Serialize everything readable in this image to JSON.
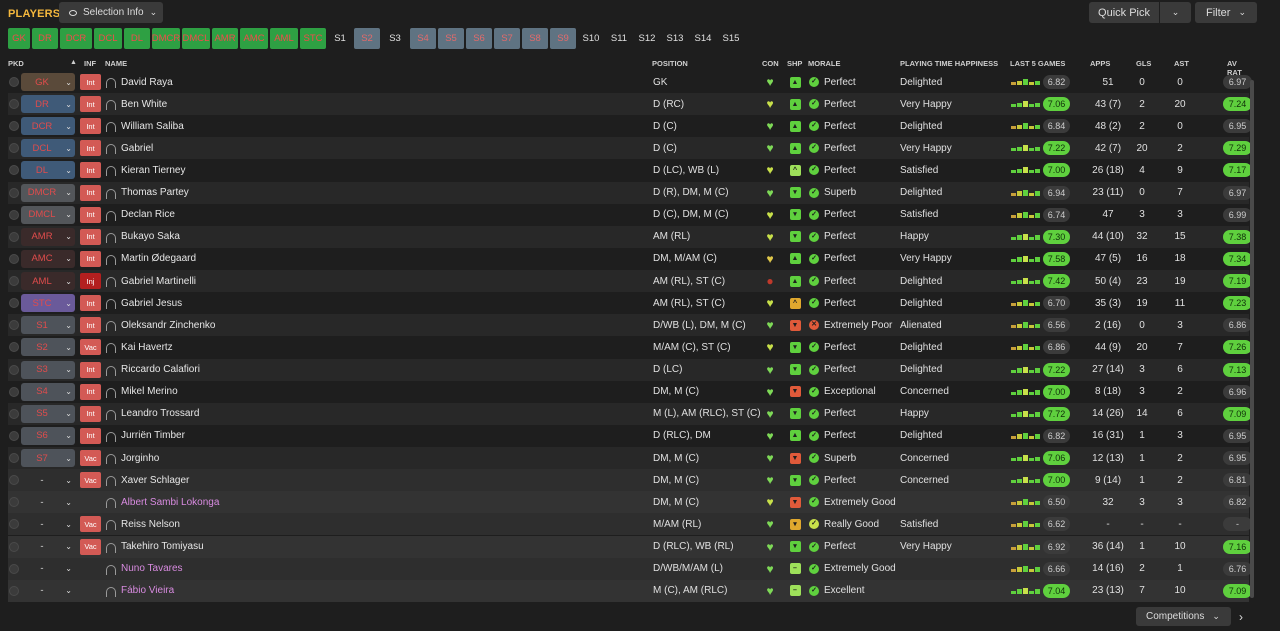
{
  "header": {
    "title": "PLAYERS",
    "selection_info": "Selection Info",
    "quick_pick": "Quick Pick",
    "filter": "Filter"
  },
  "position_tabs": [
    {
      "label": "GK",
      "style": "green",
      "w": 22
    },
    {
      "label": "DR",
      "style": "green",
      "w": 26
    },
    {
      "label": "DCR",
      "style": "green",
      "w": 32
    },
    {
      "label": "DCL",
      "style": "green",
      "w": 28
    },
    {
      "label": "DL",
      "style": "green",
      "w": 26
    },
    {
      "label": "DMCR",
      "style": "green",
      "w": 28
    },
    {
      "label": "DMCL",
      "style": "green",
      "w": 28
    },
    {
      "label": "AMR",
      "style": "green",
      "w": 26
    },
    {
      "label": "AMC",
      "style": "green",
      "w": 28
    },
    {
      "label": "AML",
      "style": "green",
      "w": 28
    },
    {
      "label": "STC",
      "style": "green",
      "w": 26
    },
    {
      "label": "S1",
      "style": "dark",
      "w": 24
    },
    {
      "label": "S2",
      "style": "slate",
      "w": 26
    },
    {
      "label": "S3",
      "style": "dark",
      "w": 26
    },
    {
      "label": "S4",
      "style": "slate",
      "w": 26
    },
    {
      "label": "S5",
      "style": "slate",
      "w": 26
    },
    {
      "label": "S6",
      "style": "slate",
      "w": 26
    },
    {
      "label": "S7",
      "style": "slate",
      "w": 26
    },
    {
      "label": "S8",
      "style": "slate",
      "w": 26
    },
    {
      "label": "S9",
      "style": "slate",
      "w": 26
    },
    {
      "label": "S10",
      "style": "dark",
      "w": 26
    },
    {
      "label": "S11",
      "style": "dark",
      "w": 26
    },
    {
      "label": "S12",
      "style": "dark",
      "w": 26
    },
    {
      "label": "S13",
      "style": "dark",
      "w": 26
    },
    {
      "label": "S14",
      "style": "dark",
      "w": 26
    },
    {
      "label": "S15",
      "style": "dark",
      "w": 26
    }
  ],
  "columns": {
    "pkd": "PKD",
    "inf": "INF",
    "name": "NAME",
    "position": "POSITION",
    "con": "CON",
    "shp": "SHP",
    "morale": "MORALE",
    "pth": "PLAYING TIME HAPPINESS",
    "last5": "LAST 5 GAMES",
    "apps": "APPS",
    "gls": "GLS",
    "ast": "AST",
    "avrat": "AV RAT"
  },
  "players": [
    {
      "pkd": "GK",
      "pkd_style": "gk",
      "inf": "Int",
      "name": "David Raya",
      "position": "GK",
      "con": "#7ed957",
      "shp": "#5fd03e",
      "shp_glyph": "▲",
      "morale": "Perfect",
      "morale_color": "#5fd03e",
      "pth": "Delighted",
      "last5": "6.82",
      "last5_g": false,
      "apps": "51",
      "gls": "0",
      "ast": "0",
      "avrat": "6.97",
      "avrat_g": false
    },
    {
      "pkd": "DR",
      "pkd_style": "def",
      "inf": "Int",
      "name": "Ben White",
      "position": "D (RC)",
      "con": "#c8e04a",
      "shp": "#5fd03e",
      "shp_glyph": "▲",
      "morale": "Perfect",
      "morale_color": "#5fd03e",
      "pth": "Very Happy",
      "last5": "7.06",
      "last5_g": true,
      "apps": "43 (7)",
      "gls": "2",
      "ast": "20",
      "avrat": "7.24",
      "avrat_g": true
    },
    {
      "pkd": "DCR",
      "pkd_style": "def",
      "inf": "Int",
      "name": "William Saliba",
      "position": "D (C)",
      "con": "#7ed957",
      "shp": "#5fd03e",
      "shp_glyph": "▲",
      "morale": "Perfect",
      "morale_color": "#5fd03e",
      "pth": "Delighted",
      "last5": "6.84",
      "last5_g": false,
      "apps": "48 (2)",
      "gls": "2",
      "ast": "0",
      "avrat": "6.95",
      "avrat_g": false
    },
    {
      "pkd": "DCL",
      "pkd_style": "def",
      "inf": "Int",
      "name": "Gabriel",
      "position": "D (C)",
      "con": "#7ed957",
      "shp": "#5fd03e",
      "shp_glyph": "▲",
      "morale": "Perfect",
      "morale_color": "#5fd03e",
      "pth": "Very Happy",
      "last5": "7.22",
      "last5_g": true,
      "apps": "42 (7)",
      "gls": "20",
      "ast": "2",
      "avrat": "7.29",
      "avrat_g": true
    },
    {
      "pkd": "DL",
      "pkd_style": "def",
      "inf": "Int",
      "name": "Kieran Tierney",
      "position": "D (LC), WB (L)",
      "con": "#c8e04a",
      "shp": "#9ee05a",
      "shp_glyph": "^",
      "morale": "Perfect",
      "morale_color": "#5fd03e",
      "pth": "Satisfied",
      "last5": "7.00",
      "last5_g": true,
      "apps": "26 (18)",
      "gls": "4",
      "ast": "9",
      "avrat": "7.17",
      "avrat_g": true
    },
    {
      "pkd": "DMCR",
      "pkd_style": "mid",
      "inf": "Int",
      "name": "Thomas Partey",
      "position": "D (R), DM, M (C)",
      "con": "#7ed957",
      "shp": "#5fd03e",
      "shp_glyph": "▾",
      "morale": "Superb",
      "morale_color": "#5fd03e",
      "pth": "Delighted",
      "last5": "6.94",
      "last5_g": false,
      "apps": "23 (11)",
      "gls": "0",
      "ast": "7",
      "avrat": "6.97",
      "avrat_g": false
    },
    {
      "pkd": "DMCL",
      "pkd_style": "mid",
      "inf": "Int",
      "name": "Declan Rice",
      "position": "D (C), DM, M (C)",
      "con": "#c8e04a",
      "shp": "#5fd03e",
      "shp_glyph": "▾",
      "morale": "Perfect",
      "morale_color": "#5fd03e",
      "pth": "Satisfied",
      "last5": "6.74",
      "last5_g": false,
      "apps": "47",
      "gls": "3",
      "ast": "3",
      "avrat": "6.99",
      "avrat_g": false
    },
    {
      "pkd": "AMR",
      "pkd_style": "att",
      "inf": "Int",
      "name": "Bukayo Saka",
      "position": "AM (RL)",
      "con": "#c8e04a",
      "shp": "#5fd03e",
      "shp_glyph": "▾",
      "morale": "Perfect",
      "morale_color": "#5fd03e",
      "pth": "Happy",
      "last5": "7.30",
      "last5_g": true,
      "apps": "44 (10)",
      "gls": "32",
      "ast": "15",
      "avrat": "7.38",
      "avrat_g": true
    },
    {
      "pkd": "AMC",
      "pkd_style": "att",
      "inf": "Int",
      "name": "Martin Ødegaard",
      "position": "DM, M/AM (C)",
      "con": "#e0c84a",
      "shp": "#5fd03e",
      "shp_glyph": "▲",
      "morale": "Perfect",
      "morale_color": "#5fd03e",
      "pth": "Very Happy",
      "last5": "7.58",
      "last5_g": true,
      "apps": "47 (5)",
      "gls": "16",
      "ast": "18",
      "avrat": "7.34",
      "avrat_g": true
    },
    {
      "pkd": "AML",
      "pkd_style": "att",
      "inf": "Inj",
      "name": "Gabriel Martinelli",
      "position": "AM (RL), ST (C)",
      "con": "#c0392b",
      "shp": "#5fd03e",
      "shp_glyph": "▲",
      "morale": "Perfect",
      "morale_color": "#5fd03e",
      "pth": "Delighted",
      "last5": "7.42",
      "last5_g": true,
      "apps": "50 (4)",
      "gls": "23",
      "ast": "19",
      "avrat": "7.19",
      "avrat_g": true
    },
    {
      "pkd": "STC",
      "pkd_style": "stc",
      "inf": "Int",
      "name": "Gabriel Jesus",
      "position": "AM (RL), ST (C)",
      "con": "#c8e04a",
      "shp": "#e0a82e",
      "shp_glyph": "^",
      "morale": "Perfect",
      "morale_color": "#5fd03e",
      "pth": "Delighted",
      "last5": "6.70",
      "last5_g": false,
      "apps": "35 (3)",
      "gls": "19",
      "ast": "11",
      "avrat": "7.23",
      "avrat_g": true
    },
    {
      "pkd": "S1",
      "pkd_style": "sub",
      "inf": "Int",
      "name": "Oleksandr Zinchenko",
      "position": "D/WB (L), DM, M (C)",
      "con": "#7ed957",
      "shp": "#e05a3a",
      "shp_glyph": "▼",
      "morale": "Extremely Poor",
      "morale_color": "#e05a3a",
      "pth": "Alienated",
      "last5": "6.56",
      "last5_g": false,
      "apps": "2 (16)",
      "gls": "0",
      "ast": "3",
      "avrat": "6.86",
      "avrat_g": false
    },
    {
      "pkd": "S2",
      "pkd_style": "sub",
      "inf": "Vac",
      "name": "Kai Havertz",
      "position": "M/AM (C), ST (C)",
      "con": "#c8e04a",
      "shp": "#5fd03e",
      "shp_glyph": "▾",
      "morale": "Perfect",
      "morale_color": "#5fd03e",
      "pth": "Delighted",
      "last5": "6.86",
      "last5_g": false,
      "apps": "44 (9)",
      "gls": "20",
      "ast": "7",
      "avrat": "7.26",
      "avrat_g": true
    },
    {
      "pkd": "S3",
      "pkd_style": "sub",
      "inf": "Int",
      "name": "Riccardo Calafiori",
      "position": "D (LC)",
      "con": "#7ed957",
      "shp": "#5fd03e",
      "shp_glyph": "▾",
      "morale": "Perfect",
      "morale_color": "#5fd03e",
      "pth": "Delighted",
      "last5": "7.22",
      "last5_g": true,
      "apps": "27 (14)",
      "gls": "3",
      "ast": "6",
      "avrat": "7.13",
      "avrat_g": true
    },
    {
      "pkd": "S4",
      "pkd_style": "sub",
      "inf": "Int",
      "name": "Mikel Merino",
      "position": "DM, M (C)",
      "con": "#7ed957",
      "shp": "#e05a3a",
      "shp_glyph": "▼",
      "morale": "Exceptional",
      "morale_color": "#5fd03e",
      "pth": "Concerned",
      "last5": "7.00",
      "last5_g": true,
      "apps": "8 (18)",
      "gls": "3",
      "ast": "2",
      "avrat": "6.96",
      "avrat_g": false
    },
    {
      "pkd": "S5",
      "pkd_style": "sub",
      "inf": "Int",
      "name": "Leandro Trossard",
      "position": "M (L), AM (RLC), ST (C)",
      "con": "#7ed957",
      "shp": "#5fd03e",
      "shp_glyph": "▾",
      "morale": "Perfect",
      "morale_color": "#5fd03e",
      "pth": "Happy",
      "last5": "7.72",
      "last5_g": true,
      "apps": "14 (26)",
      "gls": "14",
      "ast": "6",
      "avrat": "7.09",
      "avrat_g": true
    },
    {
      "pkd": "S6",
      "pkd_style": "sub",
      "inf": "Int",
      "name": "Jurriën Timber",
      "position": "D (RLC), DM",
      "con": "#7ed957",
      "shp": "#5fd03e",
      "shp_glyph": "▲",
      "morale": "Perfect",
      "morale_color": "#5fd03e",
      "pth": "Delighted",
      "last5": "6.82",
      "last5_g": false,
      "apps": "16 (31)",
      "gls": "1",
      "ast": "3",
      "avrat": "6.95",
      "avrat_g": false
    },
    {
      "pkd": "S7",
      "pkd_style": "sub",
      "inf": "Vac",
      "name": "Jorginho",
      "position": "DM, M (C)",
      "con": "#7ed957",
      "shp": "#e05a3a",
      "shp_glyph": "▼",
      "morale": "Superb",
      "morale_color": "#5fd03e",
      "pth": "Concerned",
      "last5": "7.06",
      "last5_g": true,
      "apps": "12 (13)",
      "gls": "1",
      "ast": "2",
      "avrat": "6.95",
      "avrat_g": false
    },
    {
      "pkd": "-",
      "pkd_style": "res",
      "inf": "Vac",
      "name": "Xaver Schlager",
      "position": "DM, M (C)",
      "con": "#7ed957",
      "shp": "#5fd03e",
      "shp_glyph": "▾",
      "morale": "Perfect",
      "morale_color": "#5fd03e",
      "pth": "Concerned",
      "last5": "7.00",
      "last5_g": true,
      "apps": "9 (14)",
      "gls": "1",
      "ast": "2",
      "avrat": "6.81",
      "avrat_g": false
    },
    {
      "pkd": "-",
      "pkd_style": "res",
      "inf": "",
      "name": "Albert Sambi Lokonga",
      "position": "DM, M (C)",
      "loan": true,
      "con": "#c8e04a",
      "shp": "#e05a3a",
      "shp_glyph": "▼",
      "morale": "Extremely Good",
      "morale_color": "#5fd03e",
      "pth": "",
      "last5": "6.50",
      "last5_g": false,
      "apps": "32",
      "gls": "3",
      "ast": "3",
      "avrat": "6.82",
      "avrat_g": false
    },
    {
      "pkd": "-",
      "pkd_style": "res",
      "inf": "Vac",
      "name": "Reiss Nelson",
      "position": "M/AM (RL)",
      "con": "#7ed957",
      "shp": "#e0a82e",
      "shp_glyph": "▾",
      "morale": "Really Good",
      "morale_color": "#c8e04a",
      "pth": "Satisfied",
      "last5": "6.62",
      "last5_g": false,
      "apps": "-",
      "gls": "-",
      "ast": "-",
      "avrat": "-",
      "avrat_g": false
    },
    {
      "pkd": "-",
      "pkd_style": "res",
      "inf": "Vac",
      "name": "Takehiro Tomiyasu",
      "position": "D (RLC), WB (RL)",
      "con": "#7ed957",
      "shp": "#5fd03e",
      "shp_glyph": "▾",
      "morale": "Perfect",
      "morale_color": "#5fd03e",
      "pth": "Very Happy",
      "last5": "6.92",
      "last5_g": false,
      "apps": "36 (14)",
      "gls": "1",
      "ast": "10",
      "avrat": "7.16",
      "avrat_g": true
    },
    {
      "pkd": "-",
      "pkd_style": "res",
      "inf": "",
      "name": "Nuno Tavares",
      "position": "D/WB/M/AM (L)",
      "loan": true,
      "con": "#7ed957",
      "shp": "#9ee05a",
      "shp_glyph": "–",
      "morale": "Extremely Good",
      "morale_color": "#5fd03e",
      "pth": "",
      "last5": "6.66",
      "last5_g": false,
      "apps": "14 (16)",
      "gls": "2",
      "ast": "1",
      "avrat": "6.76",
      "avrat_g": false
    },
    {
      "pkd": "-",
      "pkd_style": "res",
      "inf": "",
      "name": "Fábio Vieira",
      "position": "M (C), AM (RLC)",
      "loan": true,
      "con": "#7ed957",
      "shp": "#9ee05a",
      "shp_glyph": "–",
      "morale": "Excellent",
      "morale_color": "#5fd03e",
      "pth": "",
      "last5": "7.04",
      "last5_g": true,
      "apps": "23 (13)",
      "gls": "7",
      "ast": "10",
      "avrat": "7.09",
      "avrat_g": true
    }
  ],
  "footer": {
    "competitions": "Competitions"
  },
  "colors": {
    "title": "#f5b83d",
    "green_rating": "#5fd03e"
  }
}
